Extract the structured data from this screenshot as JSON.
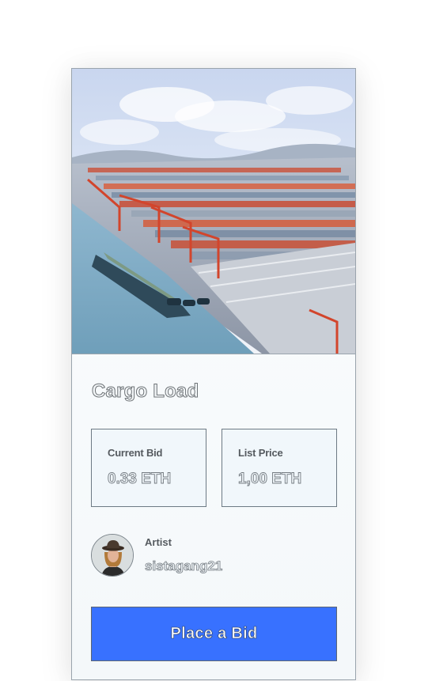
{
  "nft": {
    "title": "Cargo Load",
    "image_subject": "aerial view of container port with cranes and ship"
  },
  "current_bid": {
    "label": "Current Bid",
    "value": "0.33 ETH"
  },
  "list_price": {
    "label": "List Price",
    "value": "1,00 ETH"
  },
  "artist": {
    "label": "Artist",
    "name": "sistagang21"
  },
  "action": {
    "label": "Place a Bid"
  },
  "colors": {
    "button": "#3871ff",
    "card_background": "#f4f8fa",
    "border": "#9aa4ad"
  },
  "icons": {
    "avatar": "artist-avatar-photo"
  }
}
